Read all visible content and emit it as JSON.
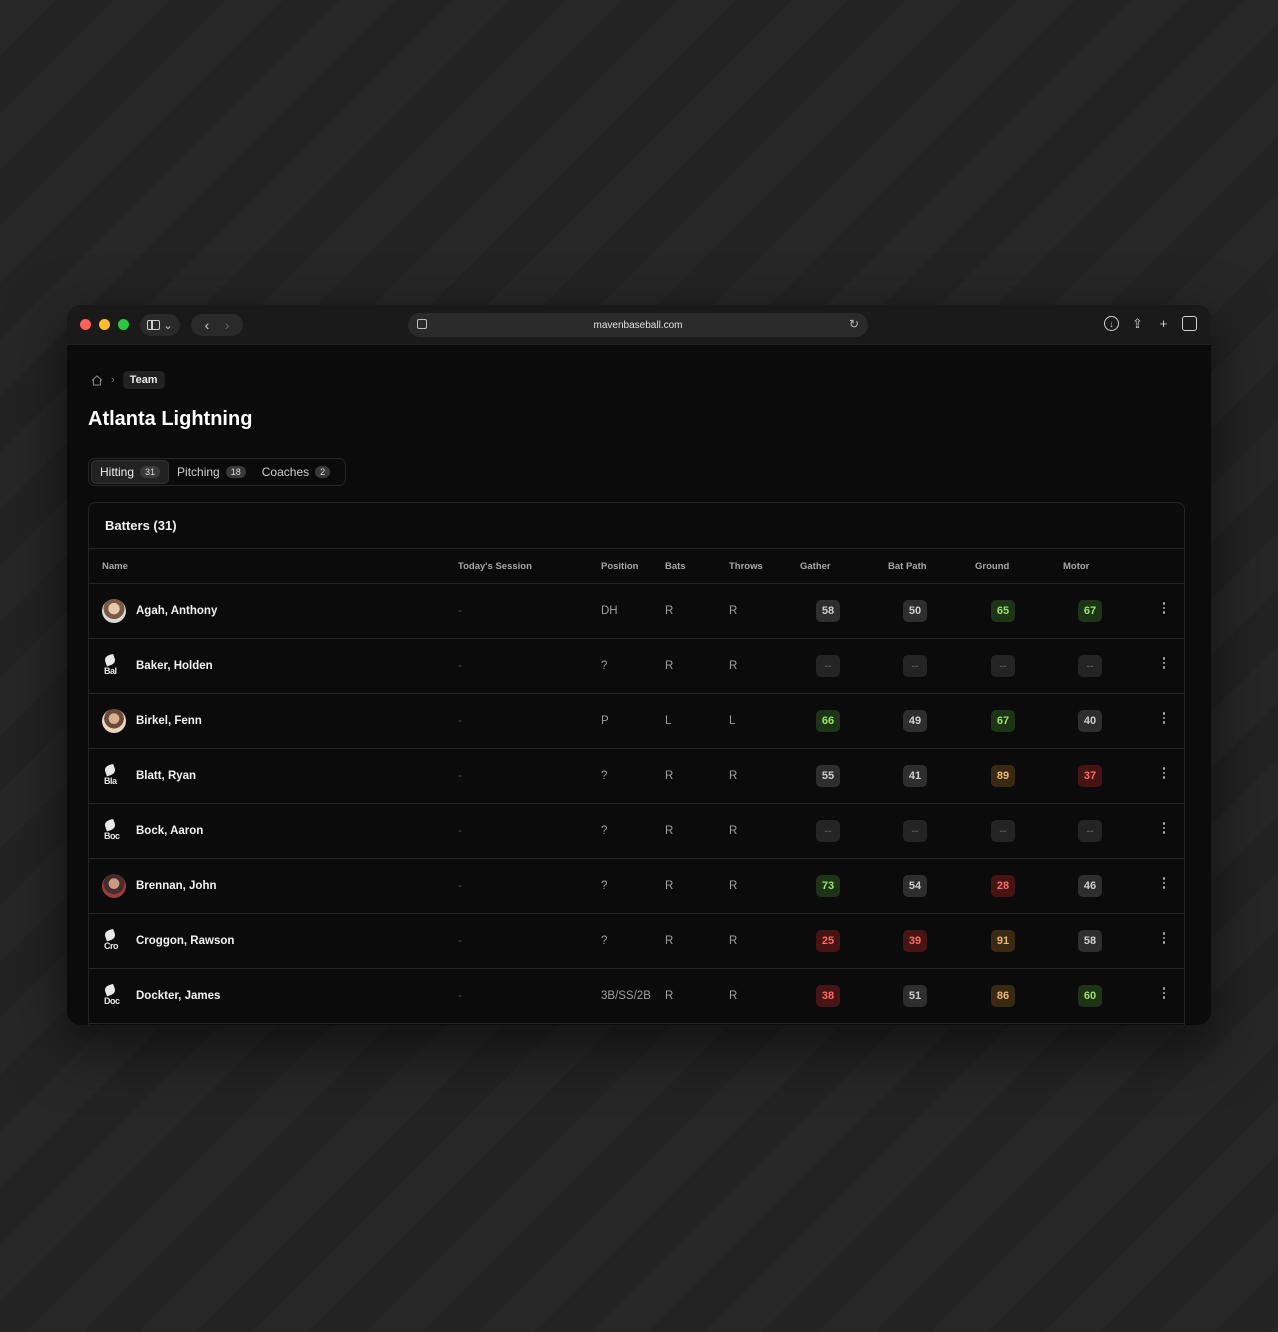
{
  "browser": {
    "url": "mavenbaseball.com"
  },
  "breadcrumb": {
    "current": "Team"
  },
  "page": {
    "title": "Atlanta Lightning"
  },
  "tabs": [
    {
      "label": "Hitting",
      "count": "31",
      "active": true
    },
    {
      "label": "Pitching",
      "count": "18",
      "active": false
    },
    {
      "label": "Coaches",
      "count": "2",
      "active": false
    }
  ],
  "card": {
    "title": "Batters (31)"
  },
  "table": {
    "columns": [
      "Name",
      "Today's Session",
      "Position",
      "Bats",
      "Throws",
      "Gather",
      "Bat Path",
      "Ground",
      "Motor"
    ],
    "rows": [
      {
        "name": "Agah, Anthony",
        "avatar": "photo",
        "avatar_fragment": "",
        "session": "-",
        "position": "DH",
        "bats": "R",
        "throws": "R",
        "gather": "58",
        "gather_tone": "gray",
        "bat_path": "50",
        "bat_path_tone": "gray",
        "ground": "65",
        "ground_tone": "green",
        "motor": "67",
        "motor_tone": "green"
      },
      {
        "name": "Baker, Holden",
        "avatar": "broken",
        "avatar_fragment": "Bal",
        "session": "-",
        "position": "?",
        "bats": "R",
        "throws": "R",
        "gather": "--",
        "gather_tone": "empty",
        "bat_path": "--",
        "bat_path_tone": "empty",
        "ground": "--",
        "ground_tone": "empty",
        "motor": "--",
        "motor_tone": "empty"
      },
      {
        "name": "Birkel, Fenn",
        "avatar": "photo2",
        "avatar_fragment": "",
        "session": "-",
        "position": "P",
        "bats": "L",
        "throws": "L",
        "gather": "66",
        "gather_tone": "green",
        "bat_path": "49",
        "bat_path_tone": "gray",
        "ground": "67",
        "ground_tone": "green",
        "motor": "40",
        "motor_tone": "gray"
      },
      {
        "name": "Blatt, Ryan",
        "avatar": "broken",
        "avatar_fragment": "Bla",
        "session": "-",
        "position": "?",
        "bats": "R",
        "throws": "R",
        "gather": "55",
        "gather_tone": "gray",
        "bat_path": "41",
        "bat_path_tone": "gray",
        "ground": "89",
        "ground_tone": "amber",
        "motor": "37",
        "motor_tone": "red"
      },
      {
        "name": "Bock, Aaron",
        "avatar": "broken",
        "avatar_fragment": "Boc",
        "session": "-",
        "position": "?",
        "bats": "R",
        "throws": "R",
        "gather": "--",
        "gather_tone": "empty",
        "bat_path": "--",
        "bat_path_tone": "empty",
        "ground": "--",
        "ground_tone": "empty",
        "motor": "--",
        "motor_tone": "empty"
      },
      {
        "name": "Brennan, John",
        "avatar": "photo3",
        "avatar_fragment": "",
        "session": "-",
        "position": "?",
        "bats": "R",
        "throws": "R",
        "gather": "73",
        "gather_tone": "green",
        "bat_path": "54",
        "bat_path_tone": "gray",
        "ground": "28",
        "ground_tone": "red",
        "motor": "46",
        "motor_tone": "gray"
      },
      {
        "name": "Croggon, Rawson",
        "avatar": "broken",
        "avatar_fragment": "Cro",
        "session": "-",
        "position": "?",
        "bats": "R",
        "throws": "R",
        "gather": "25",
        "gather_tone": "red",
        "bat_path": "39",
        "bat_path_tone": "red",
        "ground": "91",
        "ground_tone": "amber",
        "motor": "58",
        "motor_tone": "gray"
      },
      {
        "name": "Dockter, James",
        "avatar": "broken",
        "avatar_fragment": "Doc",
        "session": "-",
        "position": "3B/SS/2B",
        "bats": "R",
        "throws": "R",
        "gather": "38",
        "gather_tone": "red",
        "bat_path": "51",
        "bat_path_tone": "gray",
        "ground": "86",
        "ground_tone": "amber",
        "motor": "60",
        "motor_tone": "green"
      }
    ]
  }
}
